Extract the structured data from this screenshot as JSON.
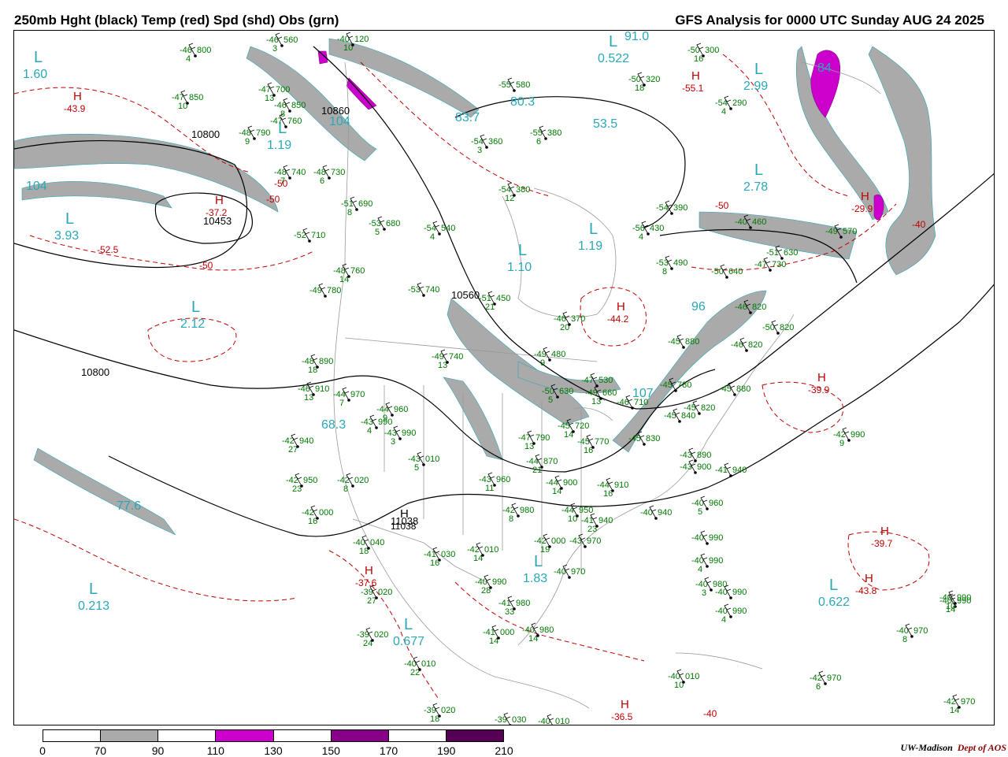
{
  "header": {
    "title_left": "250mb Hght (black) Temp (red) Spd (shd) Obs (grn)",
    "title_right": "GFS Analysis for 0000 UTC Sunday  AUG 24 2025"
  },
  "colors": {
    "height_contour": "#000000",
    "temp_contour": "#c00000",
    "speed_70_90": "#aaaaaa",
    "speed_110_130": "#cc00cc",
    "speed_150_170": "#880088",
    "speed_190_210": "#550055",
    "obs": "#007700",
    "geography": "#999999",
    "pressure_low": "#2aa8b8",
    "high_red": "#c00000",
    "high_black": "#000000"
  },
  "legend": {
    "ticks": [
      "0",
      "70",
      "90",
      "110",
      "130",
      "150",
      "170",
      "190",
      "210"
    ],
    "segments": [
      "#ffffff",
      "#aaaaaa",
      "#ffffff",
      "#cc00cc",
      "#ffffff",
      "#880088",
      "#ffffff",
      "#550055"
    ]
  },
  "credit": {
    "org": "UW-Madison",
    "dept": "Dept of AOS"
  },
  "map": {
    "height_labels": [
      "10800",
      "10453",
      "10560",
      "10800",
      "11038",
      "10860"
    ],
    "temp_labels": [
      "-50",
      "-50",
      "-52.5",
      "-50",
      "-40",
      "-50",
      "-40"
    ],
    "highs": [
      {
        "label": "H",
        "value": "-43.9",
        "kind": "temp"
      },
      {
        "label": "H",
        "value": "-37.2",
        "kind": "temp"
      },
      {
        "label": "H",
        "value": "-55.1",
        "kind": "temp"
      },
      {
        "label": "H",
        "value": "-44.2",
        "kind": "temp"
      },
      {
        "label": "H",
        "value": "-39.9",
        "kind": "temp"
      },
      {
        "label": "H",
        "value": "-29.9",
        "kind": "temp"
      },
      {
        "label": "H",
        "value": "-39.7",
        "kind": "temp"
      },
      {
        "label": "H",
        "value": "-37.6",
        "kind": "temp"
      },
      {
        "label": "H",
        "value": "-36.5",
        "kind": "temp"
      },
      {
        "label": "H",
        "value": "-43.8",
        "kind": "temp"
      },
      {
        "label": "H",
        "value": "11038",
        "kind": "height"
      }
    ],
    "lows": [
      {
        "label": "L",
        "value": "1.60"
      },
      {
        "label": "L",
        "value": "3.93"
      },
      {
        "label": "L",
        "value": "1.19"
      },
      {
        "label": "L",
        "value": "2.12"
      },
      {
        "label": "L",
        "value": "1.10"
      },
      {
        "label": "L",
        "value": "1.19"
      },
      {
        "label": "L",
        "value": "2.78"
      },
      {
        "label": "L",
        "value": "2.99"
      },
      {
        "label": "L",
        "value": "0.213"
      },
      {
        "label": "L",
        "value": "1.83"
      },
      {
        "label": "L",
        "value": "0.677"
      },
      {
        "label": "L",
        "value": "0.622"
      },
      {
        "label": "L",
        "value": "0.522"
      }
    ],
    "speed_maxima": [
      "104",
      "68.3",
      "77.6",
      "83.7",
      "80.3",
      "53.5",
      "107",
      "96",
      "104",
      "84",
      "91.0"
    ],
    "observations": [
      {
        "t": "-46",
        "h": "800",
        "w": "4"
      },
      {
        "t": "-47",
        "h": "850",
        "w": "10"
      },
      {
        "t": "-47",
        "h": "700",
        "w": "13"
      },
      {
        "t": "-46",
        "h": "850",
        "w": "8"
      },
      {
        "t": "-47",
        "h": "760",
        "w": ""
      },
      {
        "t": "-48",
        "h": "790",
        "w": "9"
      },
      {
        "t": "-48",
        "h": "740",
        "w": "7"
      },
      {
        "t": "-48",
        "h": "730",
        "w": "6"
      },
      {
        "t": "-51",
        "h": "690",
        "w": "8"
      },
      {
        "t": "-52",
        "h": "710",
        "w": ""
      },
      {
        "t": "-48",
        "h": "760",
        "w": "14"
      },
      {
        "t": "-49",
        "h": "780",
        "w": ""
      },
      {
        "t": "-48",
        "h": "890",
        "w": "18"
      },
      {
        "t": "-46",
        "h": "910",
        "w": "13"
      },
      {
        "t": "-44",
        "h": "970",
        "w": "7"
      },
      {
        "t": "-42",
        "h": "940",
        "w": "27"
      },
      {
        "t": "-42",
        "h": "950",
        "w": "23"
      },
      {
        "t": "-42",
        "h": "000",
        "w": "16"
      },
      {
        "t": "-42",
        "h": "020",
        "w": "8"
      },
      {
        "t": "-40",
        "h": "040",
        "w": "18"
      },
      {
        "t": "-44",
        "h": "960",
        "w": "9"
      },
      {
        "t": "-43",
        "h": "990",
        "w": "4"
      },
      {
        "t": "-43",
        "h": "990",
        "w": "3"
      },
      {
        "t": "-43",
        "h": "010",
        "w": "5"
      },
      {
        "t": "-41",
        "h": "030",
        "w": "16"
      },
      {
        "t": "-42",
        "h": "010",
        "w": "14"
      },
      {
        "t": "-39",
        "h": "020",
        "w": "27"
      },
      {
        "t": "-39",
        "h": "020",
        "w": "24"
      },
      {
        "t": "-40",
        "h": "010",
        "w": "22"
      },
      {
        "t": "-39",
        "h": "020",
        "w": "18"
      },
      {
        "t": "-39",
        "h": "030",
        "w": ""
      },
      {
        "t": "-40",
        "h": "010",
        "w": ""
      },
      {
        "t": "-40",
        "h": "120",
        "w": "10"
      },
      {
        "t": "-55",
        "h": "580",
        "w": ""
      },
      {
        "t": "-54",
        "h": "360",
        "w": "3"
      },
      {
        "t": "-55",
        "h": "380",
        "w": "6"
      },
      {
        "t": "-54",
        "h": "380",
        "w": "12"
      },
      {
        "t": "-53",
        "h": "680",
        "w": "5"
      },
      {
        "t": "-54",
        "h": "540",
        "w": "4"
      },
      {
        "t": "-53",
        "h": "740",
        "w": ""
      },
      {
        "t": "-51",
        "h": "450",
        "w": "21"
      },
      {
        "t": "-46",
        "h": "370",
        "w": "20"
      },
      {
        "t": "-49",
        "h": "740",
        "w": "13"
      },
      {
        "t": "-49",
        "h": "480",
        "w": "9"
      },
      {
        "t": "-47",
        "h": "530",
        "w": ""
      },
      {
        "t": "-50",
        "h": "630",
        "w": "5"
      },
      {
        "t": "-49",
        "h": "660",
        "w": "13"
      },
      {
        "t": "-46",
        "h": "710",
        "w": ""
      },
      {
        "t": "-45",
        "h": "720",
        "w": "14"
      },
      {
        "t": "-45",
        "h": "770",
        "w": "16"
      },
      {
        "t": "-47",
        "h": "790",
        "w": "13"
      },
      {
        "t": "-44",
        "h": "870",
        "w": "21"
      },
      {
        "t": "-43",
        "h": "960",
        "w": "11"
      },
      {
        "t": "-44",
        "h": "900",
        "w": "14"
      },
      {
        "t": "-42",
        "h": "980",
        "w": "8"
      },
      {
        "t": "-44",
        "h": "950",
        "w": "10"
      },
      {
        "t": "-42",
        "h": "000",
        "w": "19"
      },
      {
        "t": "-43",
        "h": "970",
        "w": ""
      },
      {
        "t": "-40",
        "h": "990",
        "w": "28"
      },
      {
        "t": "-41",
        "h": "980",
        "w": "33"
      },
      {
        "t": "-41",
        "h": "000",
        "w": "14"
      },
      {
        "t": "-40",
        "h": "980",
        "w": "14"
      },
      {
        "t": "-40",
        "h": "970",
        "w": ""
      },
      {
        "t": "-41",
        "h": "940",
        "w": "23"
      },
      {
        "t": "-44",
        "h": "910",
        "w": "16"
      },
      {
        "t": "-40",
        "h": "940",
        "w": ""
      },
      {
        "t": "-45",
        "h": "830",
        "w": ""
      },
      {
        "t": "-45",
        "h": "840",
        "w": ""
      },
      {
        "t": "-45",
        "h": "880",
        "w": ""
      },
      {
        "t": "-45",
        "h": "780",
        "w": ""
      },
      {
        "t": "-45",
        "h": "820",
        "w": ""
      },
      {
        "t": "-45",
        "h": "880",
        "w": ""
      },
      {
        "t": "-46",
        "h": "820",
        "w": ""
      },
      {
        "t": "-46",
        "h": "820",
        "w": ""
      },
      {
        "t": "-47",
        "h": "730",
        "w": ""
      },
      {
        "t": "-50",
        "h": "640",
        "w": ""
      },
      {
        "t": "-51",
        "h": "630",
        "w": ""
      },
      {
        "t": "-53",
        "h": "490",
        "w": "8"
      },
      {
        "t": "-56",
        "h": "430",
        "w": "4"
      },
      {
        "t": "-54",
        "h": "390",
        "w": ""
      },
      {
        "t": "-54",
        "h": "290",
        "w": "4"
      },
      {
        "t": "-50",
        "h": "300",
        "w": "16"
      },
      {
        "t": "-50",
        "h": "320",
        "w": "18"
      },
      {
        "t": "-43",
        "h": "890",
        "w": ""
      },
      {
        "t": "-43",
        "h": "900",
        "w": ""
      },
      {
        "t": "-41",
        "h": "940",
        "w": ""
      },
      {
        "t": "-40",
        "h": "960",
        "w": "5"
      },
      {
        "t": "-40",
        "h": "990",
        "w": ""
      },
      {
        "t": "-40",
        "h": "990",
        "w": "4"
      },
      {
        "t": "-40",
        "h": "980",
        "w": "3"
      },
      {
        "t": "-40",
        "h": "990",
        "w": ""
      },
      {
        "t": "-40",
        "h": "990",
        "w": "4"
      },
      {
        "t": "-42",
        "h": "990",
        "w": "9"
      },
      {
        "t": "-40",
        "h": "010",
        "w": "10"
      },
      {
        "t": "-42",
        "h": "970",
        "w": "6"
      },
      {
        "t": "-40",
        "h": "970",
        "w": "8"
      },
      {
        "t": "-40",
        "h": "990",
        "w": "14"
      },
      {
        "t": "-40",
        "h": "990",
        "w": "10"
      },
      {
        "t": "-42",
        "h": "970",
        "w": "14"
      },
      {
        "t": "-49",
        "h": "570",
        "w": ""
      },
      {
        "t": "-50",
        "h": "820",
        "w": ""
      },
      {
        "t": "-46",
        "h": "560",
        "w": "3"
      },
      {
        "t": "-40",
        "h": "460",
        "w": ""
      }
    ]
  }
}
